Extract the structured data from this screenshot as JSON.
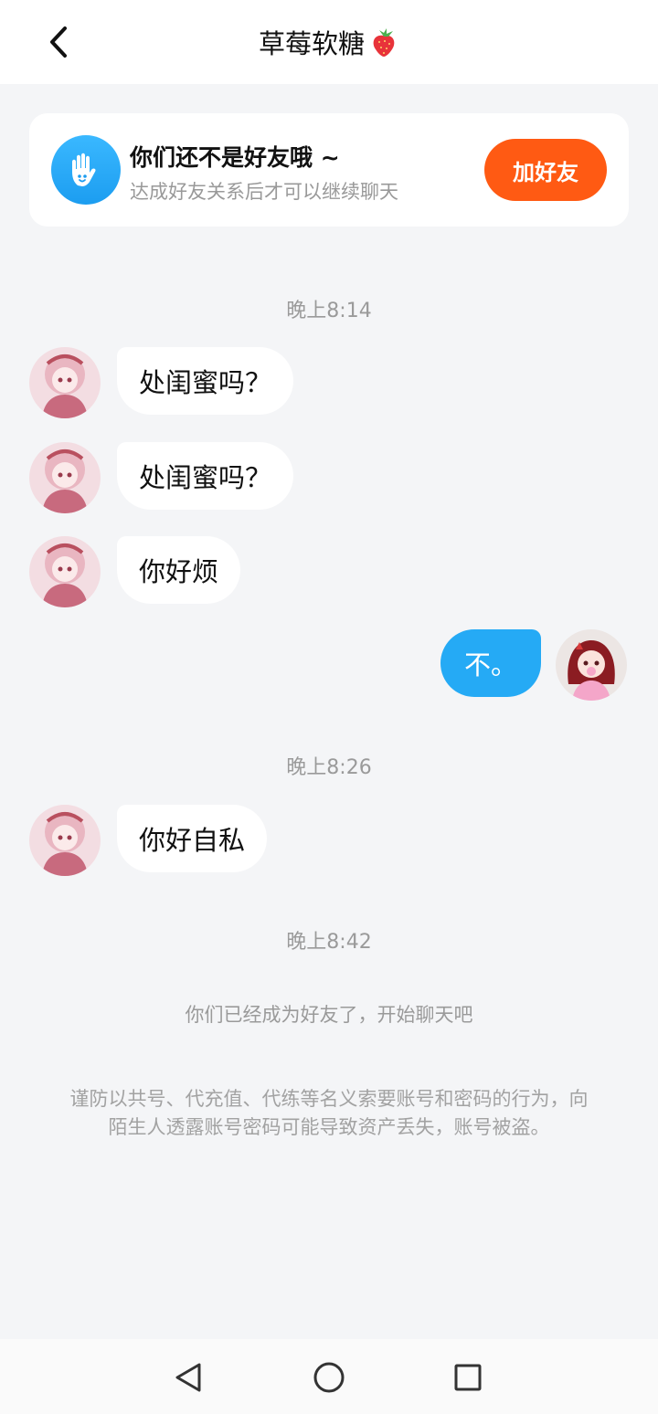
{
  "header": {
    "title": "草莓软糖",
    "title_emoji": "strawberry-icon"
  },
  "friend_card": {
    "title": "你们还不是好友哦 ~",
    "subtitle": "达成好友关系后才可以继续聊天",
    "add_button": "加好友",
    "accent_color": "#ff5a13"
  },
  "messages": {
    "time_1": "晚上8:14",
    "msg_1": "处闺蜜吗？",
    "msg_2": "处闺蜜吗？",
    "msg_3": "你好烦",
    "msg_4": "不。",
    "time_2": "晚上8:26",
    "msg_5": "你好自私",
    "time_3": "晚上8:42",
    "system_friend": "你们已经成为好友了，开始聊天吧",
    "warning": "谨防以共号、代充值、代练等名义索要账号和密码的行为，向陌生人透露账号密码可能导致资产丢失，账号被盗。"
  },
  "nav": {
    "back": "back-triangle-icon",
    "home": "home-circle-icon",
    "recents": "recents-square-icon"
  }
}
